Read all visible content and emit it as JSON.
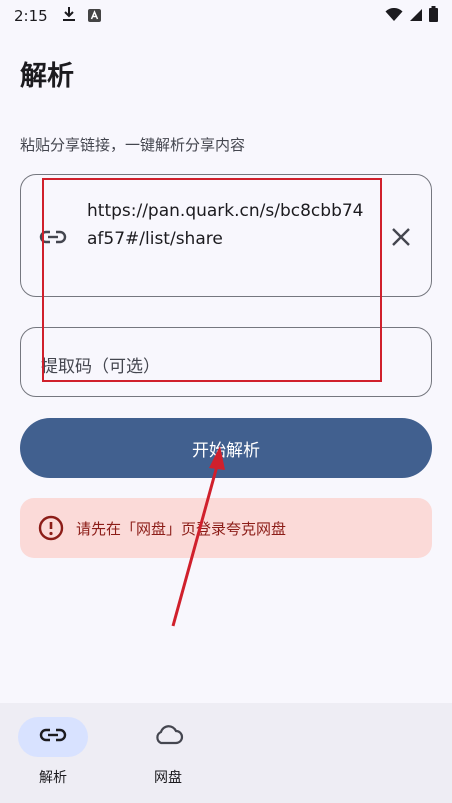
{
  "status_bar": {
    "time": "2:15",
    "icons": [
      "download-icon",
      "app-notification-icon",
      "wifi-icon",
      "signal-icon",
      "battery-icon"
    ]
  },
  "page": {
    "title": "解析",
    "hint": "粘贴分享链接，一键解析分享内容"
  },
  "link_field": {
    "value": "https://pan.quark.cn/s/bc8cbb74af57#/list/share"
  },
  "code_field": {
    "placeholder": "提取码（可选）"
  },
  "parse_button": {
    "label": "开始解析"
  },
  "alert": {
    "text": "请先在「网盘」页登录夸克网盘"
  },
  "bottom_nav": {
    "items": [
      {
        "label": "解析",
        "icon": "link-icon",
        "active": true
      },
      {
        "label": "网盘",
        "icon": "cloud-icon",
        "active": false
      }
    ]
  },
  "colors": {
    "primary": "#41608f",
    "error": "#8c1d18",
    "error_container": "#fbdad8",
    "nav_active": "#d8e2ff",
    "annotation": "#d0202c"
  }
}
